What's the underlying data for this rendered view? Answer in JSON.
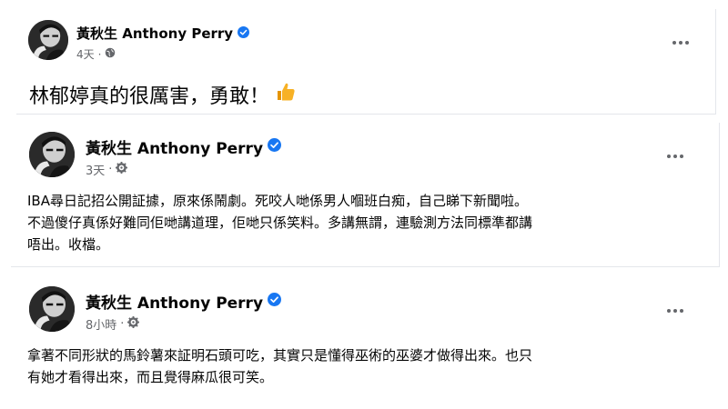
{
  "posts": [
    {
      "author": "黃秋生 Anthony Perry",
      "time": "4天",
      "dot": "·",
      "text": "林郁婷真的很厲害，勇敢！",
      "reaction_icon": "thumbs-up-icon"
    },
    {
      "author": "黃秋生 Anthony Perry",
      "time": "3天",
      "dot": "·",
      "lines": [
        "IBA尋日記招公開証據，原來係鬧劇。死咬人哋係男人嗰班白痴，自己睇下新聞啦。",
        "不過傻仔真係好難同佢哋講道理，佢哋只係笑料。多講無謂，連驗測方法同標準都講",
        "唔出。收檔。"
      ]
    },
    {
      "author": "黃秋生 Anthony Perry",
      "time": "8小時",
      "dot": "·",
      "lines": [
        "拿著不同形狀的馬鈴薯來証明石頭可吃，其實只是懂得巫術的巫婆才做得出來。也只",
        "有她才看得出來，而且覺得麻瓜很可笑。"
      ]
    }
  ],
  "colors": {
    "verified": "#1877f2",
    "meta": "#65676b",
    "text": "#050505",
    "thumb": "#f7b125"
  }
}
